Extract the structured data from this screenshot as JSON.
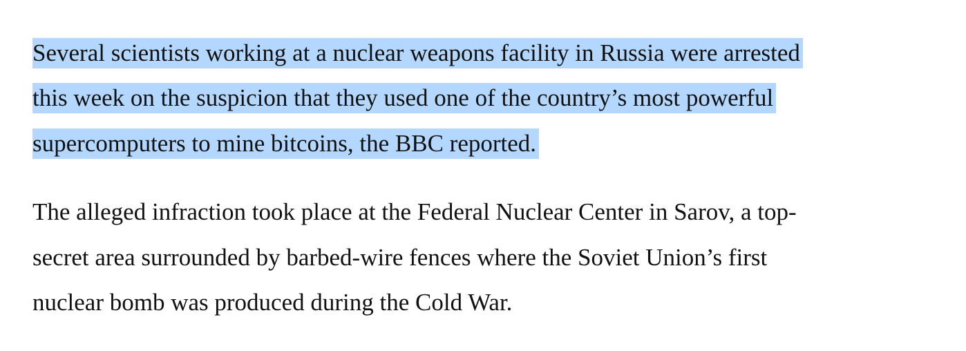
{
  "article": {
    "paragraphs": [
      {
        "selected": true,
        "lines": [
          "Several scientists working at a nuclear weapons facility in Russia were arrested",
          "this week on the suspicion that they used one of the country’s most powerful",
          "supercomputers to mine bitcoins, the BBC reported."
        ]
      },
      {
        "selected": false,
        "lines": [
          "The alleged infraction took place at the Federal Nuclear Center in Sarov, a top-",
          "secret area surrounded by barbed-wire fences where the Soviet Union’s first",
          "nuclear bomb was produced during the Cold War."
        ]
      }
    ]
  },
  "colors": {
    "selection_highlight": "#b3d7ff",
    "text": "#111111",
    "background": "#ffffff"
  }
}
